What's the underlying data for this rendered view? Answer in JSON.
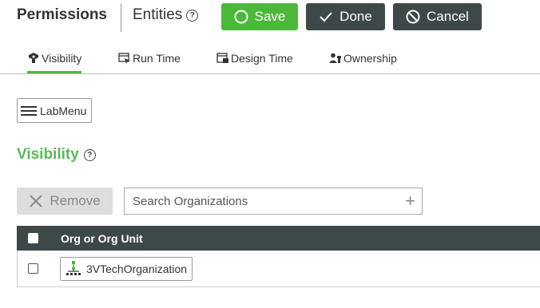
{
  "header": {
    "title": "Permissions",
    "entities_label": "Entities",
    "help_glyph": "?",
    "save_label": "Save",
    "done_label": "Done",
    "cancel_label": "Cancel"
  },
  "tabs": [
    {
      "label": "Visibility",
      "icon": "eye-shield-icon",
      "active": true
    },
    {
      "label": "Run Time",
      "icon": "run-window-icon",
      "active": false
    },
    {
      "label": "Design Time",
      "icon": "design-window-icon",
      "active": false
    },
    {
      "label": "Ownership",
      "icon": "owner-key-icon",
      "active": false
    }
  ],
  "menu": {
    "label": "LabMenu"
  },
  "section": {
    "title": "Visibility",
    "help_glyph": "?"
  },
  "toolbar": {
    "remove_label": "Remove",
    "search_placeholder": "Search Organizations"
  },
  "table": {
    "column_header": "Org or Org Unit",
    "rows": [
      {
        "name": "3VTechOrganization",
        "icon": "org-tree-icon",
        "checked": false
      }
    ]
  },
  "colors": {
    "accent_green": "#4cb83a",
    "dark_button": "#3e4849",
    "section_title_green": "#5cb85c"
  }
}
